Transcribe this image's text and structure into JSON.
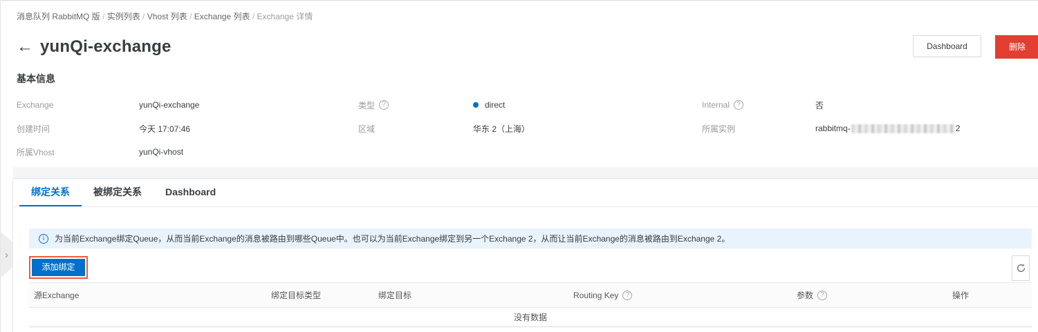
{
  "breadcrumb": {
    "items": [
      "消息队列 RabbitMQ 版",
      "实例列表",
      "Vhost 列表",
      "Exchange 列表"
    ],
    "current": "Exchange 详情"
  },
  "header": {
    "title": "yunQi-exchange",
    "dashboard_button": "Dashboard",
    "delete_button": "删除"
  },
  "basic_info": {
    "section_title": "基本信息",
    "fields": [
      {
        "label": "Exchange",
        "value": "yunQi-exchange"
      },
      {
        "label": "类型",
        "value": "direct"
      },
      {
        "label": "Internal",
        "value": "否"
      },
      {
        "label": "创建时间",
        "value": "今天 17:07:46"
      },
      {
        "label": "区域",
        "value": "华东 2（上海）"
      },
      {
        "label": "所属实例",
        "value_prefix": "rabbitmq-",
        "value_suffix": "2"
      },
      {
        "label": "所属Vhost",
        "value": "yunQi-vhost"
      }
    ]
  },
  "tabs": [
    {
      "label": "绑定关系"
    },
    {
      "label": "被绑定关系"
    },
    {
      "label": "Dashboard"
    }
  ],
  "binding_tab": {
    "notice": "为当前Exchange绑定Queue，从而当前Exchange的消息被路由到哪些Queue中。也可以为当前Exchange绑定到另一个Exchange 2，从而让当前Exchange的消息被路由到Exchange 2。",
    "add_button": "添加绑定",
    "table": {
      "columns": [
        {
          "label": "源Exchange"
        },
        {
          "label": "绑定目标类型"
        },
        {
          "label": "绑定目标"
        },
        {
          "label": "Routing Key"
        },
        {
          "label": "参数"
        },
        {
          "label": "操作"
        }
      ],
      "empty_text": "没有数据"
    }
  },
  "colors": {
    "accent_blue": "#0070cc",
    "danger_red": "#e23e31",
    "annotation_orange": "#f0583c",
    "notice_bg": "#e9f3fd"
  }
}
